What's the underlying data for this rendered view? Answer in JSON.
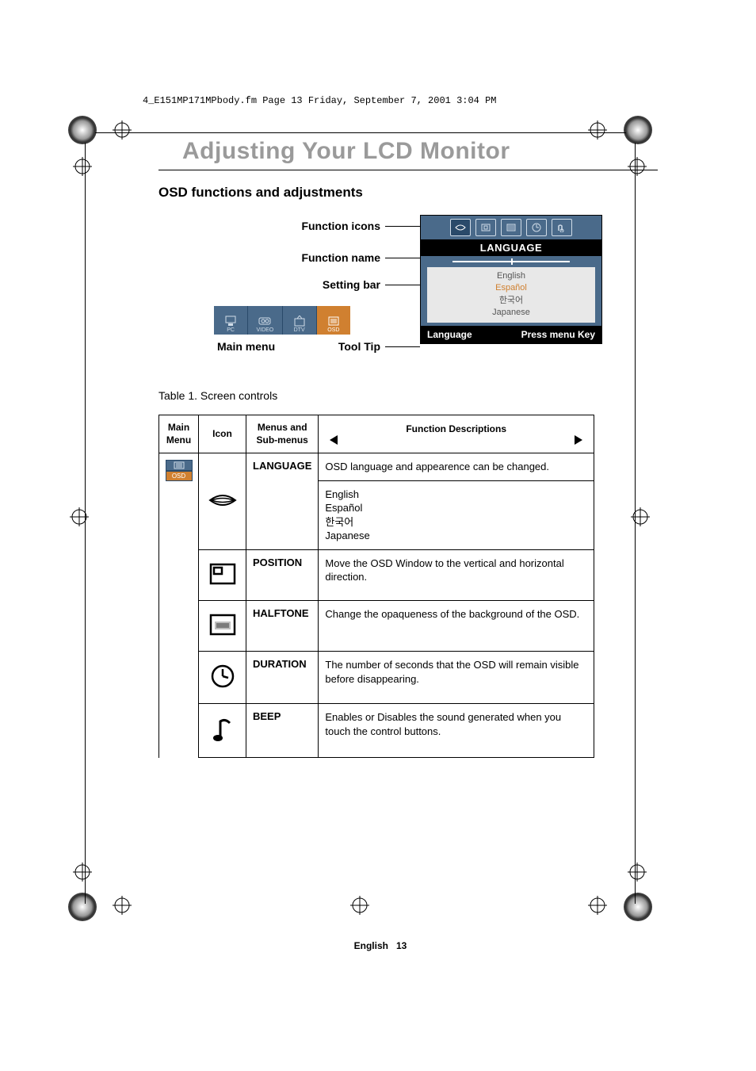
{
  "header_line": "4_E151MP171MPbody.fm  Page 13  Friday, September 7, 2001  3:04 PM",
  "title": "Adjusting Your LCD Monitor",
  "section": "OSD functions and adjustments",
  "labels": {
    "function_icons": "Function icons",
    "function_name": "Function name",
    "setting_bar": "Setting bar",
    "main_menu": "Main menu",
    "tool_tip": "Tool Tip"
  },
  "osd": {
    "title": "LANGUAGE",
    "langs": [
      "English",
      "Español",
      "한국어",
      "Japanese"
    ],
    "footer_left": "Language",
    "footer_right": "Press menu Key"
  },
  "mainmenu": {
    "items": [
      "PC",
      "VIDEO",
      "DTV",
      "OSD"
    ]
  },
  "table_caption": "Table 1.  Screen controls",
  "th": {
    "main_menu": "Main Menu",
    "icon": "Icon",
    "menus": "Menus and Sub-menus",
    "fd": "Function Descriptions"
  },
  "rows": [
    {
      "menu": "LANGUAGE",
      "desc": "OSD language and appearence can be changed.",
      "langs": [
        "English",
        "Español",
        "한국어",
        "Japanese"
      ]
    },
    {
      "menu": "POSITION",
      "desc": "Move the OSD Window to the vertical and horizontal direction."
    },
    {
      "menu": "HALFTONE",
      "desc": "Change the opaqueness of the background of the OSD."
    },
    {
      "menu": "DURATION",
      "desc": "The number of seconds that the OSD will remain visible before disappearing."
    },
    {
      "menu": "BEEP",
      "desc": "Enables or Disables the sound generated when you touch the control buttons."
    }
  ],
  "footer": {
    "lang": "English",
    "page": "13"
  },
  "osd_cell_label": "OSD"
}
